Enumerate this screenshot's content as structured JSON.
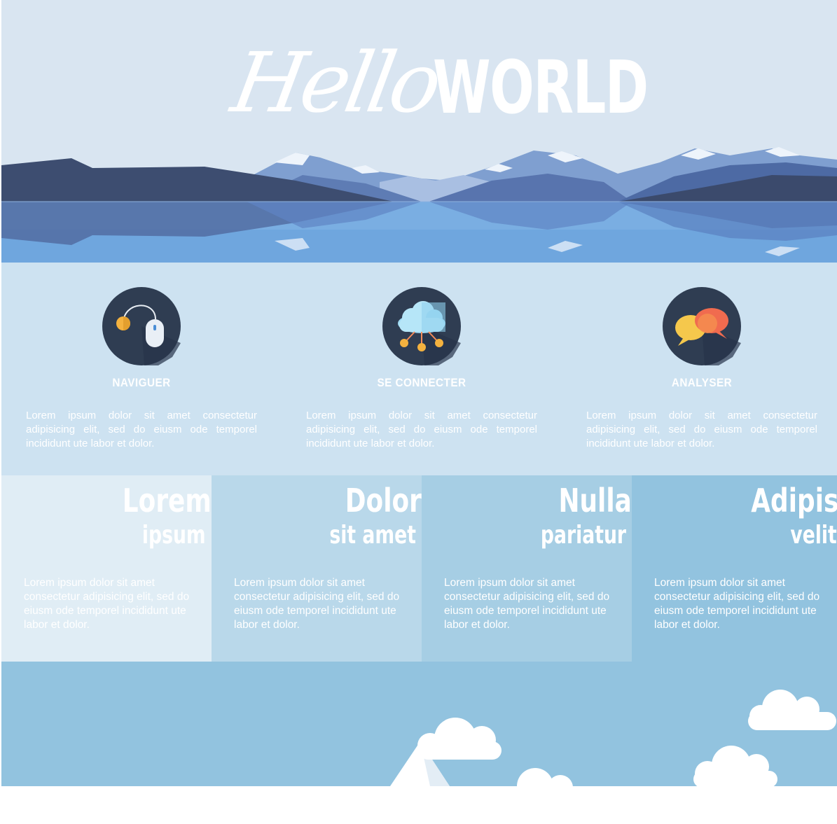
{
  "hero": {
    "title_script": "Hello",
    "title_bold": "WORLD"
  },
  "features": [
    {
      "icon": "mouse-icon",
      "title": "NAVIGUER",
      "text": "Lorem ipsum dolor sit amet consectetur adipisicing elit, sed do eiusm ode temporel incididunt ute labor et dolor."
    },
    {
      "icon": "cloud-network-icon",
      "title": "SE CONNECTER",
      "text": "Lorem ipsum dolor sit amet consectetur adipisicing elit, sed do eiusm ode temporel incididunt ute labor et dolor."
    },
    {
      "icon": "chat-bubbles-icon",
      "title": "ANALYSER",
      "text": "Lorem ipsum dolor sit amet consectetur adipisicing elit, sed do eiusm ode temporel incididunt ute labor et dolor."
    }
  ],
  "columns": [
    {
      "heading": "Lorem",
      "subheading": "ipsum",
      "text": "Lorem ipsum dolor sit amet consectetur adipisicing elit, sed do eiusm ode temporel incididunt ute labor et dolor.",
      "bg": "#e0edf5"
    },
    {
      "heading": "Dolor",
      "subheading": "sit amet",
      "text": "Lorem ipsum dolor sit amet consectetur adipisicing elit, sed do eiusm ode temporel incididunt ute labor et dolor.",
      "bg": "#b9d8ea"
    },
    {
      "heading": "Nulla",
      "subheading": "pariatur",
      "text": "Lorem ipsum dolor sit amet consectetur adipisicing elit, sed do eiusm ode temporel incididunt ute labor et dolor.",
      "bg": "#a6cee4"
    },
    {
      "heading": "Adipis",
      "subheading": "velit",
      "text": "Lorem ipsum dolor sit amet consectetur adipisicing elit, sed do eiusm ode temporel incididunt ute labor et dolor.",
      "bg": "#92c3df"
    }
  ],
  "colors": {
    "hero_sky": "#d9e5f1",
    "features_bg": "#cde2f1",
    "bottom_bg": "#92c3df",
    "icon_circle": "#2f3d52",
    "text": "#ffffff"
  }
}
